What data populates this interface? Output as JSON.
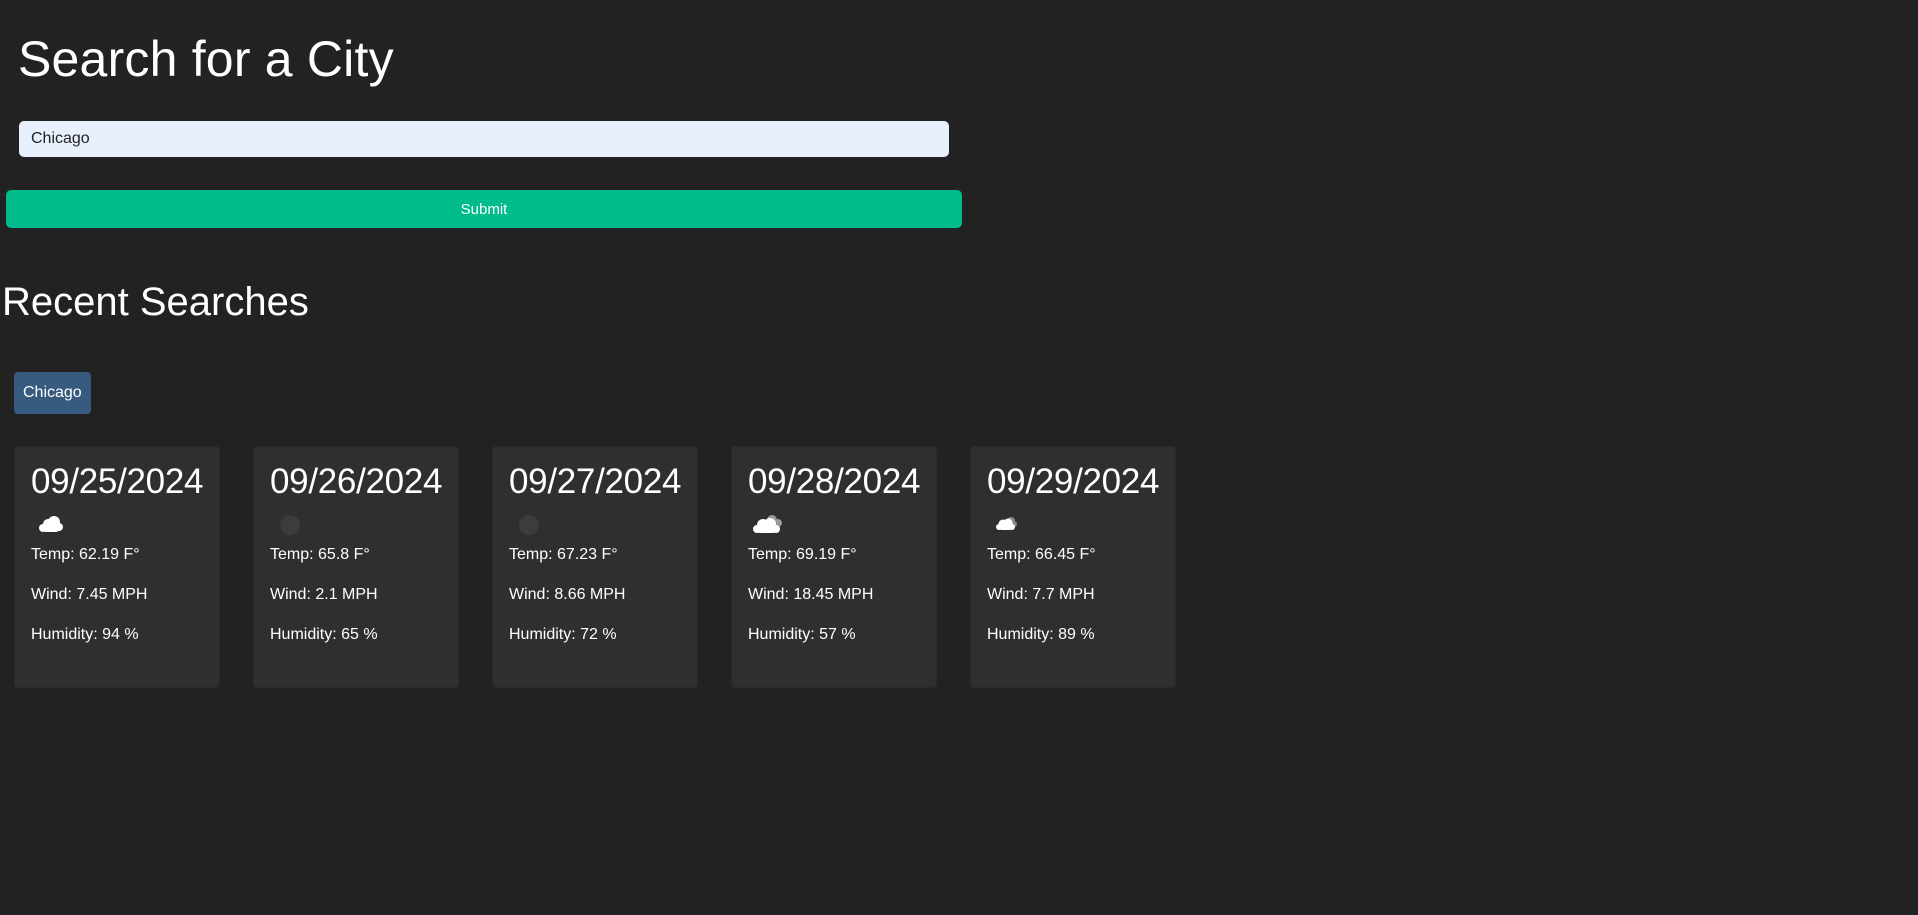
{
  "search": {
    "title": "Search for a City",
    "input_value": "Chicago",
    "submit_label": "Submit"
  },
  "recent": {
    "title": "Recent Searches",
    "items": [
      "Chicago"
    ]
  },
  "forecast": [
    {
      "date": "09/25/2024",
      "icon": "cloud-icon",
      "temp": "Temp: 62.19 F°",
      "wind": "Wind: 7.45 MPH",
      "humidity": "Humidity: 94 %"
    },
    {
      "date": "09/26/2024",
      "icon": "clear-icon",
      "temp": "Temp: 65.8 F°",
      "wind": "Wind: 2.1 MPH",
      "humidity": "Humidity: 65 %"
    },
    {
      "date": "09/27/2024",
      "icon": "clear-icon",
      "temp": "Temp: 67.23 F°",
      "wind": "Wind: 8.66 MPH",
      "humidity": "Humidity: 72 %"
    },
    {
      "date": "09/28/2024",
      "icon": "broken-clouds-icon",
      "temp": "Temp: 69.19 F°",
      "wind": "Wind: 18.45 MPH",
      "humidity": "Humidity: 57 %"
    },
    {
      "date": "09/29/2024",
      "icon": "scattered-clouds-icon",
      "temp": "Temp: 66.45 F°",
      "wind": "Wind: 7.7 MPH",
      "humidity": "Humidity: 89 %"
    }
  ],
  "colors": {
    "background": "#222222",
    "card": "#2f2f2f",
    "submit": "#00bc8c",
    "history_button": "#375a7f",
    "input": "#e8f0fe"
  }
}
